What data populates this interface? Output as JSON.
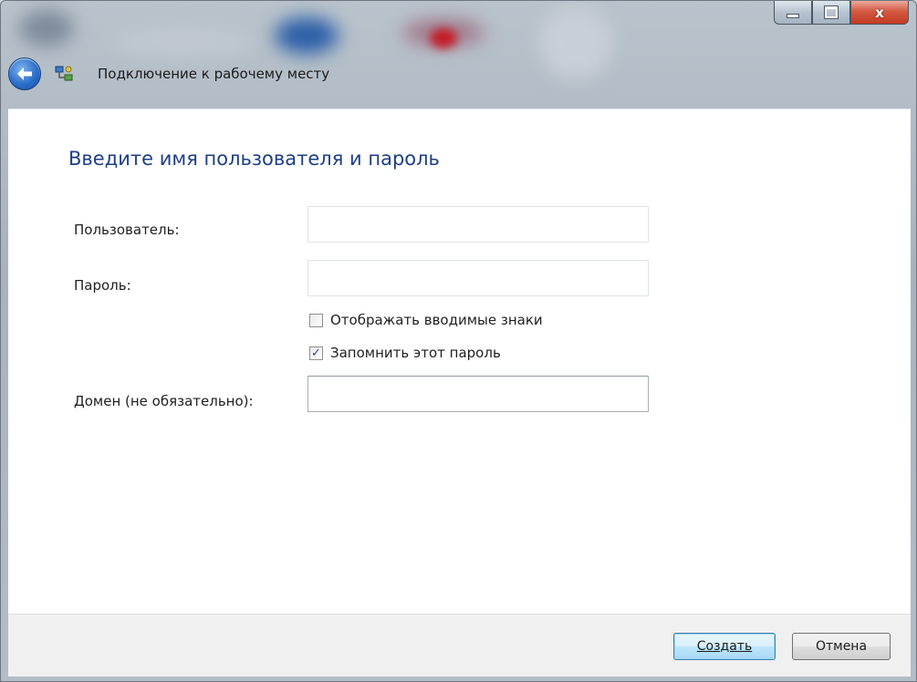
{
  "window": {
    "title": "Подключение к рабочему месту",
    "close_glyph": "x"
  },
  "form": {
    "heading": "Введите имя пользователя и пароль",
    "user_label": "Пользователь:",
    "user_value": "",
    "password_label": "Пароль:",
    "password_value": "",
    "show_chars_label": "Отображать вводимые знаки",
    "show_chars_checked": false,
    "remember_label": "Запомнить этот пароль",
    "remember_checked": true,
    "domain_label": "Домен (не обязательно):",
    "domain_value": ""
  },
  "buttons": {
    "create": "Создать",
    "cancel": "Отмена"
  },
  "icons": {
    "back": "back-arrow-icon",
    "app": "network-connection-icon",
    "check": "✓"
  },
  "colors": {
    "heading": "#1e3f85",
    "close_button": "#c33a22",
    "back_button": "#2b6fcb"
  }
}
